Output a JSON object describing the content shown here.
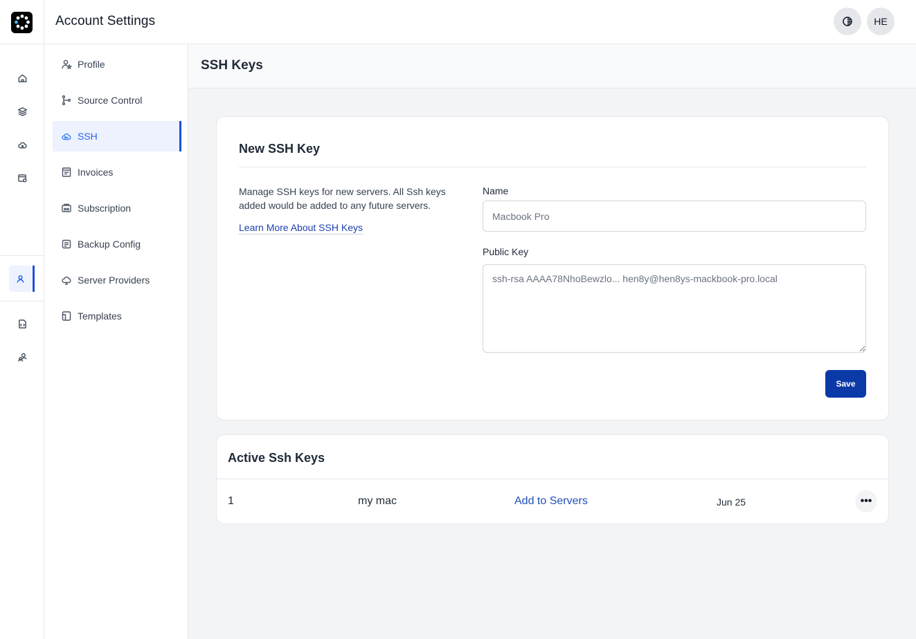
{
  "header": {
    "app_title": "Account Settings",
    "theme_icon": "contrast-icon",
    "avatar_initials": "HE"
  },
  "rail": {
    "items": [
      {
        "icon": "home-icon"
      },
      {
        "icon": "layers-icon"
      },
      {
        "icon": "cloud-icon"
      },
      {
        "icon": "calendar-icon"
      },
      {
        "icon": "user-icon",
        "active": true
      },
      {
        "icon": "code-icon"
      },
      {
        "icon": "users-icon"
      }
    ]
  },
  "settings_nav": {
    "items": [
      {
        "label": "Profile",
        "icon": "user-star-icon"
      },
      {
        "label": "Source Control",
        "icon": "git-branch-icon"
      },
      {
        "label": "SSH",
        "icon": "cloud-key-icon",
        "active": true
      },
      {
        "label": "Invoices",
        "icon": "receipt-icon"
      },
      {
        "label": "Subscription",
        "icon": "subscription-icon"
      },
      {
        "label": "Backup Config",
        "icon": "backup-icon"
      },
      {
        "label": "Server Providers",
        "icon": "cloud-server-icon"
      },
      {
        "label": "Templates",
        "icon": "template-icon"
      }
    ]
  },
  "main": {
    "page_title": "SSH Keys",
    "new_key": {
      "title": "New SSH Key",
      "description": "Manage SSH keys for new servers. All Ssh keys added would be added to any future servers.",
      "learn_more": "Learn More About SSH Keys",
      "name_label": "Name",
      "name_placeholder": "Macbook Pro",
      "public_key_label": "Public Key",
      "public_key_placeholder": "ssh-rsa AAAA78NhoBewzlo... hen8y@hen8ys-mackbook-pro.local",
      "save_label": "Save"
    },
    "active_keys": {
      "title": "Active Ssh Keys",
      "rows": [
        {
          "index": "1",
          "name": "my mac",
          "action": "Add to Servers",
          "date": "Jun 25",
          "menu": "•••"
        }
      ]
    }
  },
  "colors": {
    "accent": "#1d4ed8",
    "button": "#0b3aa8",
    "link": "#1e40af"
  }
}
